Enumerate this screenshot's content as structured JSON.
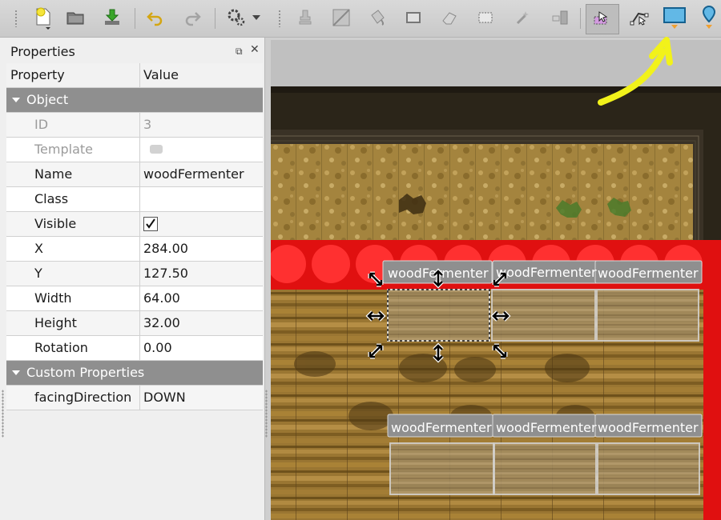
{
  "toolbar": {
    "buttons": [
      {
        "name": "new-map",
        "icon": "new-file-icon"
      },
      {
        "name": "open",
        "icon": "open-folder-icon"
      },
      {
        "name": "save",
        "icon": "save-icon"
      },
      {
        "name": "undo",
        "icon": "undo-icon"
      },
      {
        "name": "redo",
        "icon": "redo-icon"
      },
      {
        "name": "commands",
        "icon": "gears-icon"
      },
      {
        "name": "stamp-brush",
        "icon": "stamp-icon"
      },
      {
        "name": "terrain-brush",
        "icon": "terrain-icon"
      },
      {
        "name": "bucket-fill",
        "icon": "bucket-icon"
      },
      {
        "name": "shape-fill",
        "icon": "rectangle-fill-icon"
      },
      {
        "name": "eraser",
        "icon": "eraser-icon"
      },
      {
        "name": "rect-select",
        "icon": "rect-select-icon"
      },
      {
        "name": "magic-wand",
        "icon": "magic-wand-icon"
      },
      {
        "name": "select-same-tile",
        "icon": "same-tile-icon"
      },
      {
        "name": "select-objects",
        "icon": "select-objects-icon"
      },
      {
        "name": "edit-polygons",
        "icon": "edit-polygons-icon"
      },
      {
        "name": "insert-rectangle",
        "icon": "insert-rectangle-icon"
      },
      {
        "name": "insert-point",
        "icon": "insert-point-icon"
      }
    ]
  },
  "properties": {
    "title": "Properties",
    "header": {
      "property": "Property",
      "value": "Value"
    },
    "sections": {
      "object": "Object",
      "custom": "Custom Properties"
    },
    "rows": {
      "id": {
        "label": "ID",
        "value": "3"
      },
      "template": {
        "label": "Template"
      },
      "name": {
        "label": "Name",
        "value": "woodFermenter"
      },
      "class": {
        "label": "Class",
        "value": ""
      },
      "visible": {
        "label": "Visible",
        "checked": true
      },
      "x": {
        "label": "X",
        "value": "284.00"
      },
      "y": {
        "label": "Y",
        "value": "127.50"
      },
      "width": {
        "label": "Width",
        "value": "64.00"
      },
      "height": {
        "label": "Height",
        "value": "32.00"
      },
      "rotation": {
        "label": "Rotation",
        "value": "0.00"
      },
      "facing": {
        "label": "facingDirection",
        "value": "DOWN"
      }
    }
  },
  "map": {
    "objects": [
      {
        "label": "woodFermenter",
        "selected": true
      },
      {
        "label": "woodFermenter",
        "selected": false
      },
      {
        "label": "woodFermenter",
        "selected": false
      },
      {
        "label": "woodFermenter",
        "selected": false
      },
      {
        "label": "woodFermenter",
        "selected": false
      },
      {
        "label": "woodFermenter",
        "selected": false
      }
    ]
  },
  "colors": {
    "annotation_arrow": "#f2f21a",
    "collision_red": "#e01010",
    "selection_active": "#bdbdbd"
  }
}
